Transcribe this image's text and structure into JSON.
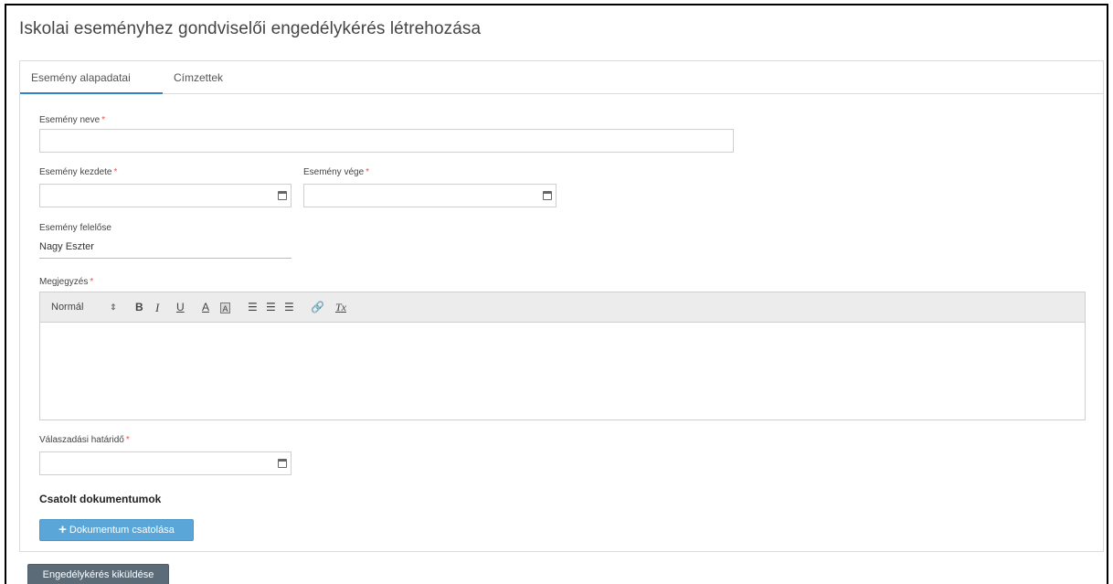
{
  "page": {
    "title": "Iskolai eseményhez gondviselői engedélykérés létrehozása"
  },
  "tabs": [
    {
      "label": "Esemény alapadatai",
      "active": true
    },
    {
      "label": "Címzettek",
      "active": false
    }
  ],
  "form": {
    "event_name": {
      "label": "Esemény neve",
      "required_mark": "*",
      "value": ""
    },
    "event_start": {
      "label": "Esemény kezdete",
      "required_mark": "*",
      "value": ""
    },
    "event_end": {
      "label": "Esemény vége",
      "required_mark": "*",
      "value": ""
    },
    "event_owner": {
      "label": "Esemény felelőse",
      "value": "Nagy Eszter"
    },
    "note": {
      "label": "Megjegyzés",
      "required_mark": "*",
      "toolbar": {
        "heading": "Normál",
        "heading_arrows": "⇕",
        "bold": "B",
        "italic": "I",
        "underline": "U",
        "color": "A",
        "background": "A",
        "ordered_list": "☰",
        "bullet_list": "☰",
        "align": "☰",
        "link": "🔗",
        "clean": "Tx"
      },
      "value": ""
    },
    "response_deadline": {
      "label": "Válaszadási határidő",
      "required_mark": "*",
      "value": ""
    }
  },
  "attachments": {
    "title": "Csatolt dokumentumok",
    "add_button_icon": "+",
    "add_button_label": "Dokumentum csatolása"
  },
  "submit": {
    "label": "Engedélykérés kiküldése"
  },
  "colors": {
    "accent": "#2f83c8",
    "attach_button": "#5aa6d8",
    "submit_button": "#5b6b78",
    "required": "#e05555"
  },
  "icons": {
    "date_picker": "calendar-icon"
  }
}
